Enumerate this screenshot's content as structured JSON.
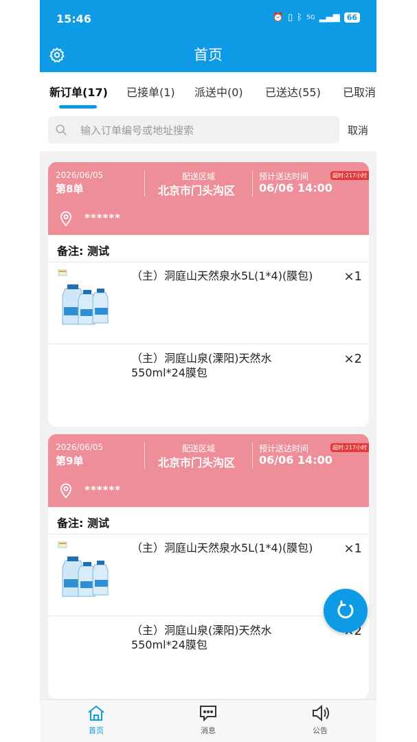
{
  "status_bar": {
    "time": "15:46",
    "network": "5G",
    "battery": "66"
  },
  "header": {
    "title": "首页"
  },
  "tabs": [
    {
      "label": "新订单(17)",
      "active": true
    },
    {
      "label": "已接单(1)",
      "active": false
    },
    {
      "label": "派送中(0)",
      "active": false
    },
    {
      "label": "已送达(55)",
      "active": false
    },
    {
      "label": "已取消",
      "active": false
    }
  ],
  "search": {
    "placeholder": "输入订单编号或地址搜索",
    "value": "",
    "cancel_label": "取消"
  },
  "orders": [
    {
      "date": "2026/06/05",
      "number": "第8单",
      "area_label": "配送区域",
      "area": "北京市门头沟区",
      "eta_label": "预计送达时间",
      "eta": "06/06 14:00",
      "overdue": "超时:217小时",
      "address": "******",
      "note": "备注: 测试",
      "items": [
        {
          "name": "（主）洞庭山天然泉水5L(1*4)(膜包)",
          "qty": "×1"
        },
        {
          "name": "（主）洞庭山泉(溧阳)天然水550ml*24膜包",
          "qty": "×2"
        }
      ]
    },
    {
      "date": "2026/06/05",
      "number": "第9单",
      "area_label": "配送区域",
      "area": "北京市门头沟区",
      "eta_label": "预计送达时间",
      "eta": "06/06 14:00",
      "overdue": "超时:217小时",
      "address": "******",
      "note": "备注: 测试",
      "items": [
        {
          "name": "（主）洞庭山天然泉水5L(1*4)(膜包)",
          "qty": "×1"
        },
        {
          "name": "（主）洞庭山泉(溧阳)天然水550ml*24膜包",
          "qty": "×2"
        }
      ]
    }
  ],
  "bottom_nav": [
    {
      "label": "首页",
      "icon": "home-icon",
      "active": true
    },
    {
      "label": "消息",
      "icon": "message-icon",
      "active": false
    },
    {
      "label": "公告",
      "icon": "speaker-icon",
      "active": false
    }
  ],
  "colors": {
    "primary": "#0d9be6",
    "card_header": "#ee8e99",
    "overdue_badge": "#e33a3a"
  }
}
